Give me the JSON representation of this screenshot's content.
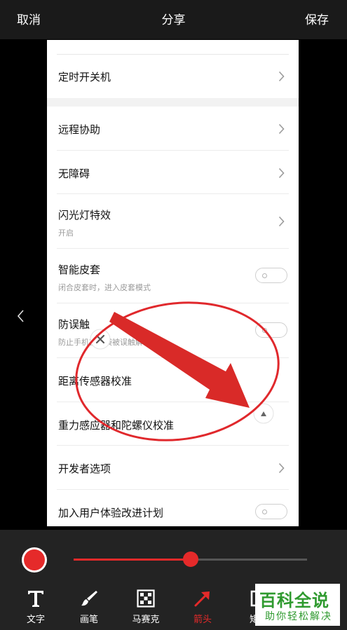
{
  "topbar": {
    "cancel": "取消",
    "title": "分享",
    "save": "保存"
  },
  "settings": {
    "rows": [
      {
        "label": "定时开关机"
      },
      {
        "label": "远程协助"
      },
      {
        "label": "无障碍"
      },
      {
        "label": "闪光灯特效",
        "sub": "开启"
      },
      {
        "label": "智能皮套",
        "sub": "闭合皮套时，进入皮套模式"
      },
      {
        "label": "防误触",
        "sub": "防止手机在口袋被误触解锁"
      },
      {
        "label": "距离传感器校准"
      },
      {
        "label": "重力感应器和陀螺仪校准"
      },
      {
        "label": "开发者选项"
      },
      {
        "label": "加入用户体验改进计划"
      }
    ]
  },
  "editor": {
    "brush_color": "#e52a2a",
    "stroke_size_fraction": 0.5,
    "tools": [
      {
        "label": "文字",
        "icon": "text-icon"
      },
      {
        "label": "画笔",
        "icon": "brush-icon"
      },
      {
        "label": "马赛克",
        "icon": "mosaic-icon"
      },
      {
        "label": "箭头",
        "icon": "arrow-icon"
      },
      {
        "label": "矩形",
        "icon": "rectangle-icon"
      }
    ]
  },
  "watermark": {
    "logo": "百科全说",
    "sub": "助你轻松解决"
  }
}
